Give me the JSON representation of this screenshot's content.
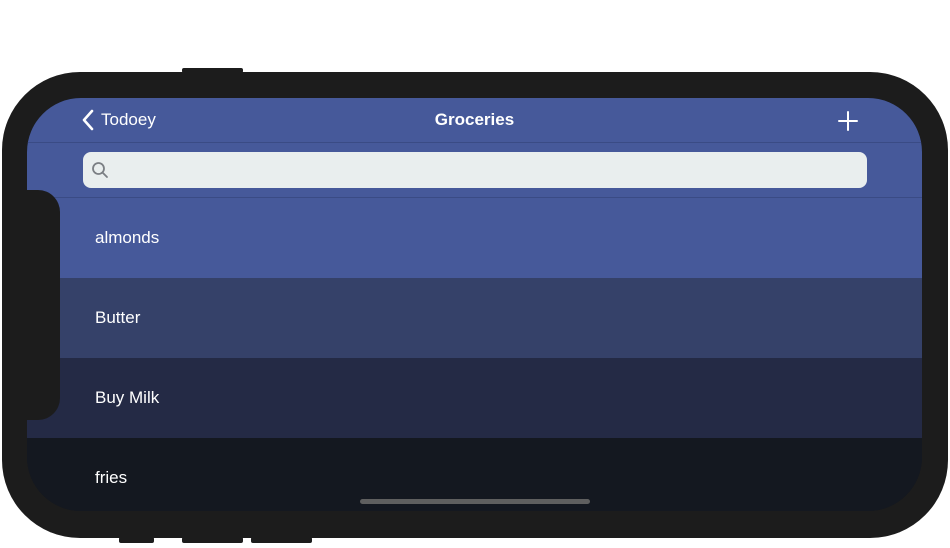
{
  "navbar": {
    "back_label": "Todoey",
    "title": "Groceries",
    "add_icon": "plus-icon",
    "back_icon": "chevron-left-icon",
    "color": "#46599a"
  },
  "search": {
    "placeholder": "",
    "value": "",
    "icon": "magnifying-glass-icon"
  },
  "items": [
    {
      "title": "almonds",
      "color": "#46599a"
    },
    {
      "title": "Butter",
      "color": "#354169"
    },
    {
      "title": "Buy Milk",
      "color": "#242a45"
    },
    {
      "title": "fries",
      "color": "#141820"
    }
  ]
}
